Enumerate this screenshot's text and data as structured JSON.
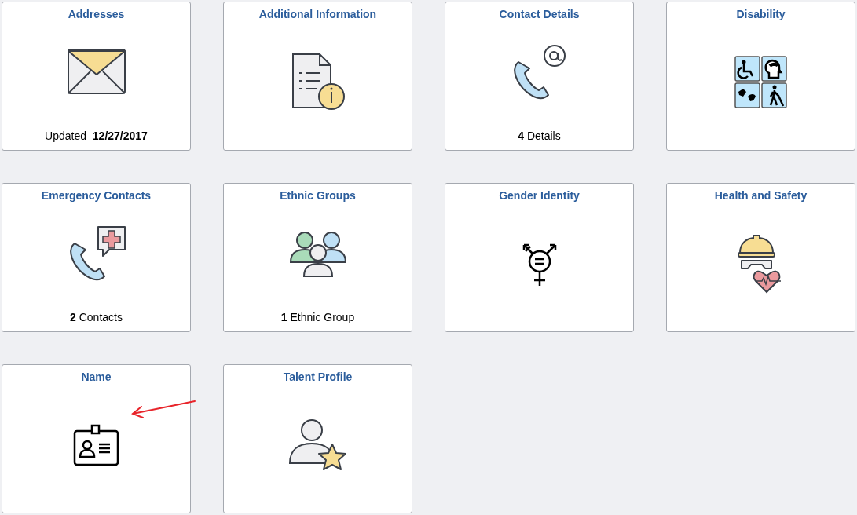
{
  "tiles": [
    {
      "title": "Addresses",
      "footer": "Updated  **12/27/2017**",
      "marked": false
    },
    {
      "title": "Additional Information",
      "marked": false
    },
    {
      "title": "Contact Details",
      "footer": "**4** Details",
      "marked": false
    },
    {
      "title": "Disability",
      "marked": false
    },
    {
      "title": "Emergency Contacts",
      "footer": "**2** Contacts",
      "marked": false
    },
    {
      "title": "Ethnic Groups",
      "footer": "**1** Ethnic Group",
      "marked": false
    },
    {
      "title": "Gender Identity",
      "marked": false
    },
    {
      "title": "Health and Safety",
      "marked": false
    },
    {
      "title": "Name",
      "marked": true
    },
    {
      "title": "Talent Profile",
      "marked": false
    }
  ]
}
